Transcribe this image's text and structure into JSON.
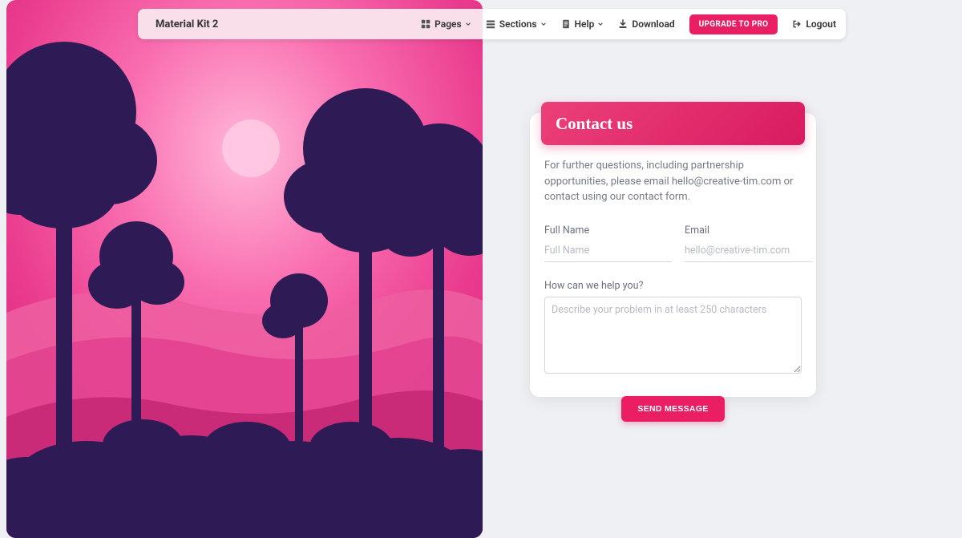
{
  "brand": "Material Kit 2",
  "nav": {
    "pages": "Pages",
    "sections": "Sections",
    "help": "Help",
    "download": "Download",
    "upgrade": "UPGRADE TO PRO",
    "logout": "Logout"
  },
  "contact": {
    "title": "Contact us",
    "description": "For further questions, including partnership opportunities, please email hello@creative-tim.com or contact using our contact form.",
    "fullName": {
      "label": "Full Name",
      "placeholder": "Full Name"
    },
    "email": {
      "label": "Email",
      "placeholder": "hello@creative-tim.com"
    },
    "help": {
      "label": "How can we help you?",
      "placeholder": "Describe your problem in at least 250 characters"
    },
    "submit": "SEND MESSAGE"
  }
}
